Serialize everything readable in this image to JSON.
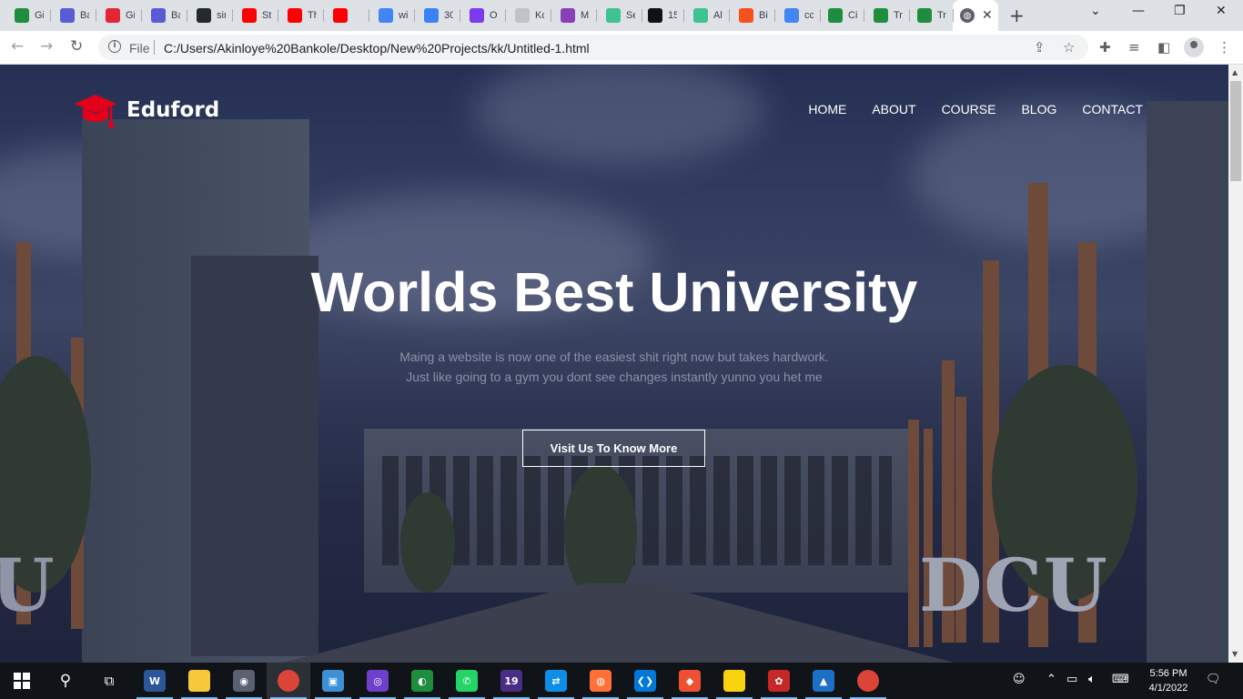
{
  "browser": {
    "tabs": [
      {
        "title": "Gi",
        "icon": "w-icon",
        "color": "#1e8e3e"
      },
      {
        "title": "Ba",
        "icon": "h-icon",
        "color": "#5b5bd6"
      },
      {
        "title": "Gi",
        "icon": "v-icon",
        "color": "#e32636"
      },
      {
        "title": "Ba",
        "icon": "h-icon",
        "color": "#5b5bd6"
      },
      {
        "title": "sir",
        "icon": "github-icon",
        "color": "#24292e"
      },
      {
        "title": "St",
        "icon": "youtube-icon",
        "color": "#ff0000"
      },
      {
        "title": "Th",
        "icon": "youtube-icon",
        "color": "#ff0000"
      },
      {
        "title": "",
        "icon": "youtube-icon",
        "color": "#ff0000"
      },
      {
        "title": "wi",
        "icon": "google-icon",
        "color": "#4285f4"
      },
      {
        "title": "30",
        "icon": "diamond-icon",
        "color": "#3b82f6"
      },
      {
        "title": "O",
        "icon": "pin-icon",
        "color": "#7c3aed"
      },
      {
        "title": "Kc",
        "icon": "k-icon",
        "color": "#bfc3c8"
      },
      {
        "title": "M",
        "icon": "chart-icon",
        "color": "#8b3fb6"
      },
      {
        "title": "Se",
        "icon": "v-icon",
        "color": "#3ec28f"
      },
      {
        "title": "15",
        "icon": "a-icon",
        "color": "#111"
      },
      {
        "title": "Al",
        "icon": "v-icon",
        "color": "#3ec28f"
      },
      {
        "title": "Bi",
        "icon": "puzzle-icon",
        "color": "#f4511e"
      },
      {
        "title": "cc",
        "icon": "google-icon",
        "color": "#4285f4"
      },
      {
        "title": "Ci",
        "icon": "w-icon",
        "color": "#1e8e3e"
      },
      {
        "title": "Tr",
        "icon": "w-icon",
        "color": "#1e8e3e"
      },
      {
        "title": "Tr",
        "icon": "w-icon",
        "color": "#1e8e3e"
      }
    ],
    "address": {
      "scheme_label": "File",
      "url": "C:/Users/Akinloye%20Bankole/Desktop/New%20Projects/kk/Untitled-1.html"
    }
  },
  "page": {
    "brand": "Eduford",
    "accent_color": "#e3001b",
    "nav": [
      "HOME",
      "ABOUT",
      "COURSE",
      "BLOG",
      "CONTACT"
    ],
    "hero": {
      "title": "Worlds Best University",
      "subtitle_line1": "Maing a website is now one of the easiest shit right now but takes hardwork.",
      "subtitle_line2": "Just like going to a gym you dont see changes instantly yunno you het me",
      "button": "Visit Us To Know More"
    },
    "background_sign": "DCU"
  },
  "taskbar": {
    "apps": [
      {
        "name": "word",
        "color": "#2b579a",
        "glyph": "W"
      },
      {
        "name": "file-explorer",
        "color": "#f6c83b",
        "glyph": ""
      },
      {
        "name": "camera",
        "color": "#5a6170",
        "glyph": "◉"
      },
      {
        "name": "chrome",
        "color": "#db4437",
        "glyph": ""
      },
      {
        "name": "app-blue",
        "color": "#3d8fd6",
        "glyph": "▣"
      },
      {
        "name": "github-desktop",
        "color": "#6e40c9",
        "glyph": "◎"
      },
      {
        "name": "app-green",
        "color": "#1e8e3e",
        "glyph": "◐"
      },
      {
        "name": "whatsapp",
        "color": "#25d366",
        "glyph": "✆"
      },
      {
        "name": "app-19",
        "color": "#4b2e83",
        "glyph": "19"
      },
      {
        "name": "teamviewer",
        "color": "#0e8ee9",
        "glyph": "⇄"
      },
      {
        "name": "firefox",
        "color": "#ff7139",
        "glyph": "◍"
      },
      {
        "name": "vscode",
        "color": "#0078d7",
        "glyph": "❮❯"
      },
      {
        "name": "git",
        "color": "#f05032",
        "glyph": "◆"
      },
      {
        "name": "sticky-notes",
        "color": "#f7d20f",
        "glyph": ""
      },
      {
        "name": "app-red",
        "color": "#c62828",
        "glyph": "✿"
      },
      {
        "name": "photos",
        "color": "#1c6fc4",
        "glyph": "▲"
      },
      {
        "name": "chrome",
        "color": "#db4437",
        "glyph": ""
      }
    ],
    "time": "5:56 PM",
    "date": "4/1/2022"
  }
}
